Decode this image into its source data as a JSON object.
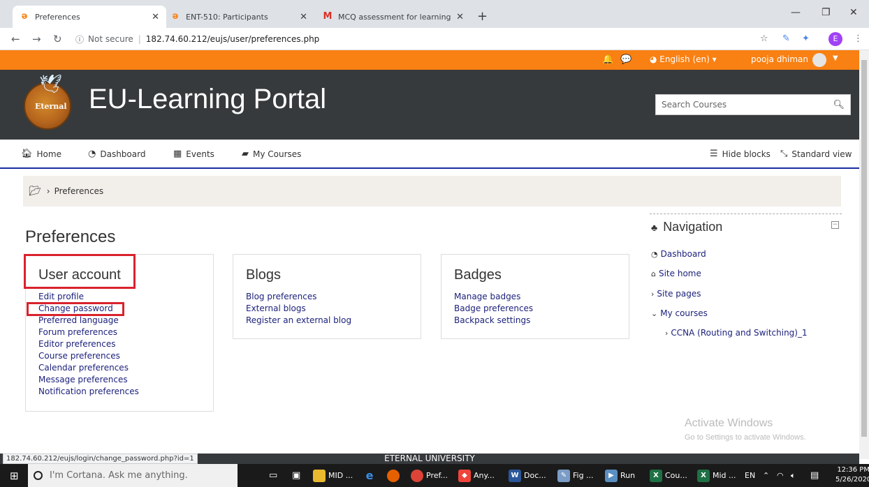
{
  "browser": {
    "tabs": [
      {
        "title": "Preferences",
        "icon": "moodle-icon"
      },
      {
        "title": "ENT-510: Participants",
        "icon": "moodle-icon"
      },
      {
        "title": "MCQ assessment for learning ED",
        "icon": "gmail-icon"
      }
    ],
    "security": "Not secure",
    "url": "182.74.60.212/eujs/user/preferences.php",
    "profile_initial": "E",
    "status_url": "182.74.60.212/eujs/login/change_password.php?id=1"
  },
  "topbar": {
    "language": "English (en)",
    "user": "pooja dhiman"
  },
  "header": {
    "logo_text": "Eternal",
    "site_name": "EU-Learning Portal",
    "search_placeholder": "Search Courses"
  },
  "nav": {
    "home": "Home",
    "dashboard": "Dashboard",
    "events": "Events",
    "my_courses": "My Courses",
    "hide_blocks": "Hide blocks",
    "standard_view": "Standard view"
  },
  "breadcrumb": {
    "current": "Preferences"
  },
  "main": {
    "title": "Preferences",
    "user_account": {
      "title": "User account",
      "links": [
        "Edit profile",
        "Change password",
        "Preferred language",
        "Forum preferences",
        "Editor preferences",
        "Course preferences",
        "Calendar preferences",
        "Message preferences",
        "Notification preferences"
      ]
    },
    "blogs": {
      "title": "Blogs",
      "links": [
        "Blog preferences",
        "External blogs",
        "Register an external blog"
      ]
    },
    "badges": {
      "title": "Badges",
      "links": [
        "Manage badges",
        "Badge preferences",
        "Backpack settings"
      ]
    }
  },
  "navigation_block": {
    "title": "Navigation",
    "dashboard": "Dashboard",
    "site_home": "Site home",
    "site_pages": "Site pages",
    "my_courses": "My courses",
    "course": "CCNA (Routing and Switching)_1"
  },
  "watermark": {
    "line1": "Activate Windows",
    "line2": "Go to Settings to activate Windows."
  },
  "footer": "ETERNAL UNIVERSITY",
  "taskbar": {
    "cortana": "I'm Cortana. Ask me anything.",
    "apps": [
      "MID ...",
      "Pref...",
      "Any...",
      "Doc...",
      "Fig ...",
      "Run",
      "Cou...",
      "Mid ..."
    ],
    "lang": "EN",
    "time": "12:36 PM",
    "date": "5/26/2020"
  }
}
